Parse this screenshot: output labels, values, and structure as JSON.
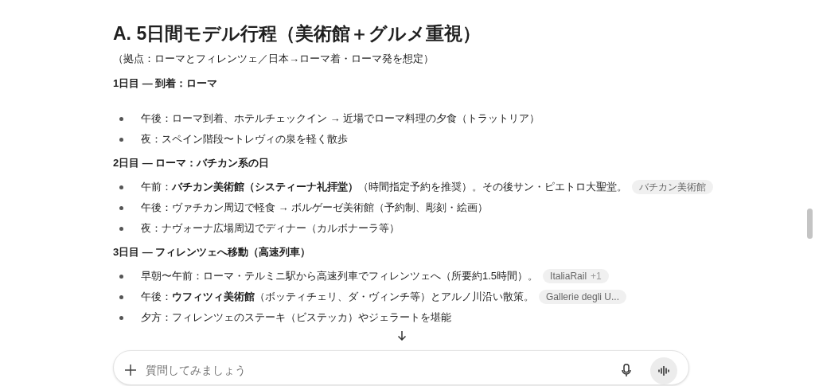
{
  "title": "A. 5日間モデル行程（美術館＋グルメ重視）",
  "subtitle": "（拠点：ローマとフィレンツェ／日本→ローマ着・ローマ発を想定）",
  "days": [
    {
      "heading": "1日目 — 到着：ローマ",
      "items": [
        {
          "text": "午後：ローマ到着、ホテルチェックイン → 近場でローマ料理の夕食（トラットリア）"
        },
        {
          "text": "夜：スペイン階段〜トレヴィの泉を軽く散歩"
        }
      ]
    },
    {
      "heading": "2日目 — ローマ：バチカン系の日",
      "items": [
        {
          "text": "午前：**バチカン美術館（システィーナ礼拝堂）**（時間指定予約を推奨）。その後サン・ピエトロ大聖堂。",
          "source": {
            "label": "バチカン美術館"
          }
        },
        {
          "text": "午後：ヴァチカン周辺で軽食 → ボルゲーゼ美術館（予約制、彫刻・絵画）"
        },
        {
          "text": "夜：ナヴォーナ広場周辺でディナー（カルボナーラ等）"
        }
      ]
    },
    {
      "heading": "3日目 — フィレンツェへ移動（高速列車）",
      "items": [
        {
          "text": "早朝〜午前：ローマ・テルミニ駅から高速列車でフィレンツェへ（所要約1.5時間）。",
          "source": {
            "label": "ItaliaRail",
            "more": "+1"
          }
        },
        {
          "text": "午後：**ウフィツィ美術館**（ボッティチェリ、ダ・ヴィンチ等）とアルノ川沿い散策。",
          "source": {
            "label": "Gallerie degli U..."
          }
        },
        {
          "text": "夕方：フィレンツェのステーキ（ビステッカ）やジェラートを堪能"
        }
      ]
    }
  ],
  "composer": {
    "placeholder": "質問してみましょう"
  }
}
